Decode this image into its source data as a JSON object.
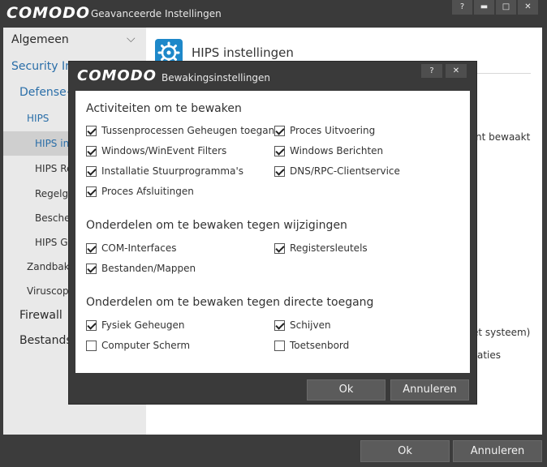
{
  "window": {
    "logo": "COMODO",
    "title": "Geavanceerde Instellingen",
    "help": "?",
    "minimize": "▬",
    "maximize": "□",
    "close": "✕"
  },
  "sidebar": {
    "items": [
      {
        "label": "Algemeen",
        "chevron": "⌵"
      },
      {
        "label": "Security Instellingen"
      },
      {
        "label": "Defense+"
      },
      {
        "label": "HIPS"
      },
      {
        "label": "HIPS instellingen"
      },
      {
        "label": "HIPS Regels"
      },
      {
        "label": "Regelgroepen"
      },
      {
        "label": "Beschermde objecten"
      },
      {
        "label": "HIPS Groepen"
      },
      {
        "label": "Zandbak"
      },
      {
        "label": "Viruscope"
      },
      {
        "label": "Firewall"
      },
      {
        "label": "Bestandsbeoordeling"
      }
    ]
  },
  "content": {
    "title": "HIPS instellingen",
    "fragment_1": "nt bewaakt",
    "fragment_2": "et systeem)",
    "fragment_3": "aties"
  },
  "footer": {
    "ok": "Ok",
    "cancel": "Annuleren"
  },
  "modal": {
    "logo": "COMODO",
    "title": "Bewakingsinstellingen",
    "help": "?",
    "close": "✕",
    "sections": [
      {
        "title": "Activiteiten om te bewaken",
        "items": [
          {
            "label": "Tussenprocessen Geheugen toegang",
            "checked": true
          },
          {
            "label": "Proces Uitvoering",
            "checked": true
          },
          {
            "label": "Windows/WinEvent Filters",
            "checked": true
          },
          {
            "label": "Windows Berichten",
            "checked": true
          },
          {
            "label": "Installatie Stuurprogramma's",
            "checked": true
          },
          {
            "label": "DNS/RPC-Clientservice",
            "checked": true
          },
          {
            "label": "Proces Afsluitingen",
            "checked": true
          }
        ]
      },
      {
        "title": "Onderdelen om te bewaken tegen wijzigingen",
        "items": [
          {
            "label": "COM-Interfaces",
            "checked": true
          },
          {
            "label": "Registersleutels",
            "checked": true
          },
          {
            "label": "Bestanden/Mappen",
            "checked": true
          }
        ]
      },
      {
        "title": "Onderdelen om te bewaken tegen directe toegang",
        "items": [
          {
            "label": "Fysiek Geheugen",
            "checked": true
          },
          {
            "label": "Schijven",
            "checked": true
          },
          {
            "label": "Computer Scherm",
            "checked": false
          },
          {
            "label": "Toetsenbord",
            "checked": false
          }
        ]
      }
    ],
    "ok": "Ok",
    "cancel": "Annuleren"
  },
  "colors": {
    "accent": "#1e88c9",
    "sidebar_link": "#2a6ea8",
    "dark_chrome": "#3a3a3a",
    "button": "#5b5b5b"
  }
}
